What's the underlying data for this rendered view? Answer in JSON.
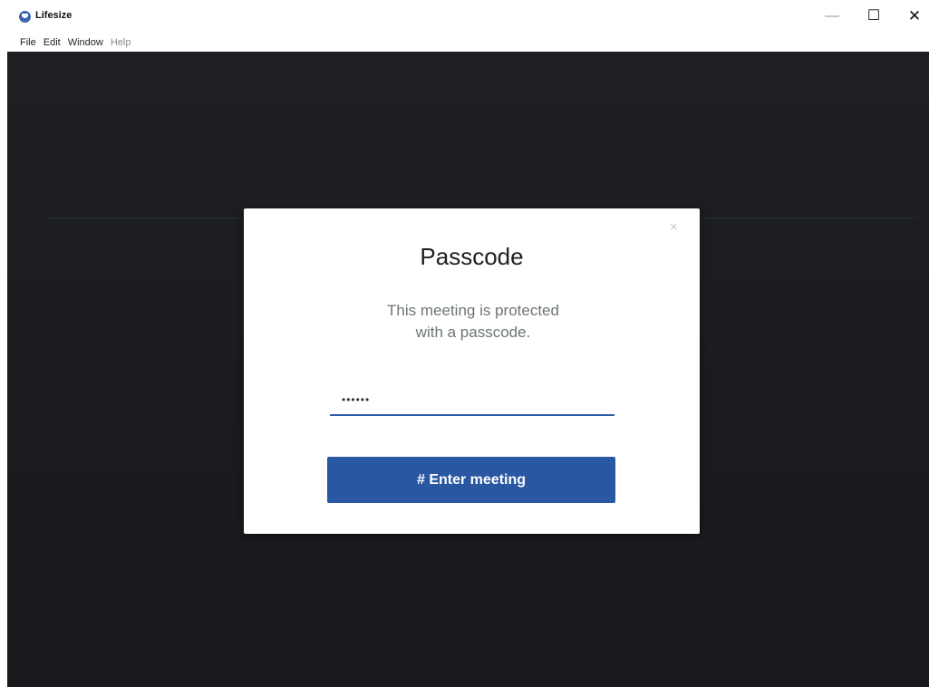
{
  "window": {
    "title": "Lifesize",
    "icon": "lifesize-logo-icon",
    "controls": {
      "minimize": "—",
      "maximize": "☐",
      "close": "✕"
    }
  },
  "menu": [
    {
      "label": "File"
    },
    {
      "label": "Edit"
    },
    {
      "label": "Window"
    },
    {
      "label": "Help"
    }
  ],
  "modal": {
    "title": "Passcode",
    "message": "This meeting is protected with a passcode.",
    "passcode_value": "••••••",
    "close_icon": "×",
    "button_label": "# Enter meeting"
  },
  "colors": {
    "accent": "#2a57a2",
    "background": "#1b1d21"
  }
}
